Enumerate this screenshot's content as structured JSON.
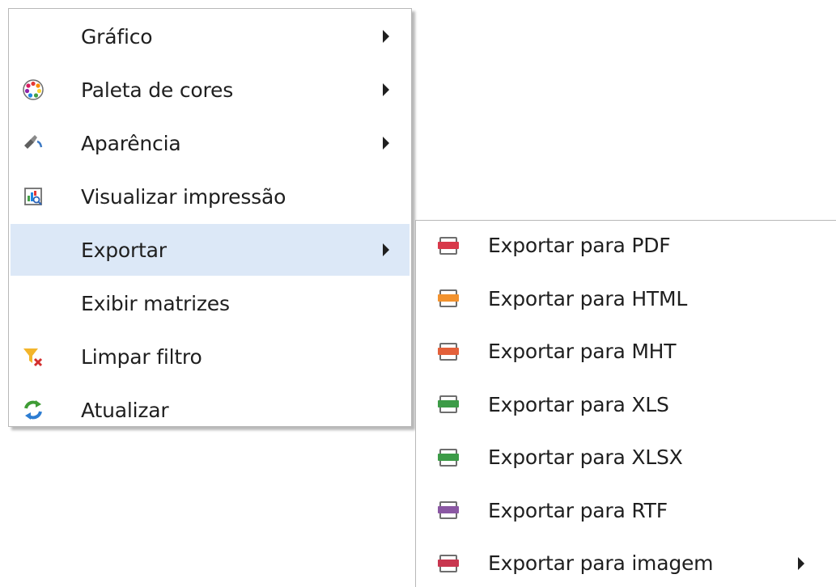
{
  "main_menu": {
    "items": [
      {
        "label": "Gráfico",
        "icon": "none",
        "has_submenu": true
      },
      {
        "label": "Paleta de cores",
        "icon": "color-palette-icon",
        "has_submenu": true
      },
      {
        "label": "Aparência",
        "icon": "appearance-brush-icon",
        "has_submenu": true
      },
      {
        "label": "Visualizar impressão",
        "icon": "print-preview-icon",
        "has_submenu": false
      },
      {
        "label": "Exportar",
        "icon": "none",
        "has_submenu": true,
        "highlighted": true
      },
      {
        "label": "Exibir matrizes",
        "icon": "none",
        "has_submenu": false
      },
      {
        "label": "Limpar filtro",
        "icon": "clear-filter-icon",
        "has_submenu": false
      },
      {
        "label": "Atualizar",
        "icon": "refresh-icon",
        "has_submenu": false
      }
    ]
  },
  "export_submenu": {
    "items": [
      {
        "label": "Exportar para PDF",
        "icon": "pdf-file-icon",
        "color": "#d8394a"
      },
      {
        "label": "Exportar para HTML",
        "icon": "html-file-icon",
        "color": "#f2922e"
      },
      {
        "label": "Exportar para MHT",
        "icon": "mht-file-icon",
        "color": "#e3603a"
      },
      {
        "label": "Exportar para XLS",
        "icon": "xls-file-icon",
        "color": "#3c9b47"
      },
      {
        "label": "Exportar para XLSX",
        "icon": "xlsx-file-icon",
        "color": "#3c9b47"
      },
      {
        "label": "Exportar para RTF",
        "icon": "rtf-file-icon",
        "color": "#8a57a3"
      },
      {
        "label": "Exportar para imagem",
        "icon": "image-file-icon",
        "color": "#c8364f",
        "has_submenu": true
      }
    ]
  },
  "colors": {
    "highlight": "#dce8f7",
    "border": "#b8b8b8",
    "text": "#1f1f1f"
  }
}
